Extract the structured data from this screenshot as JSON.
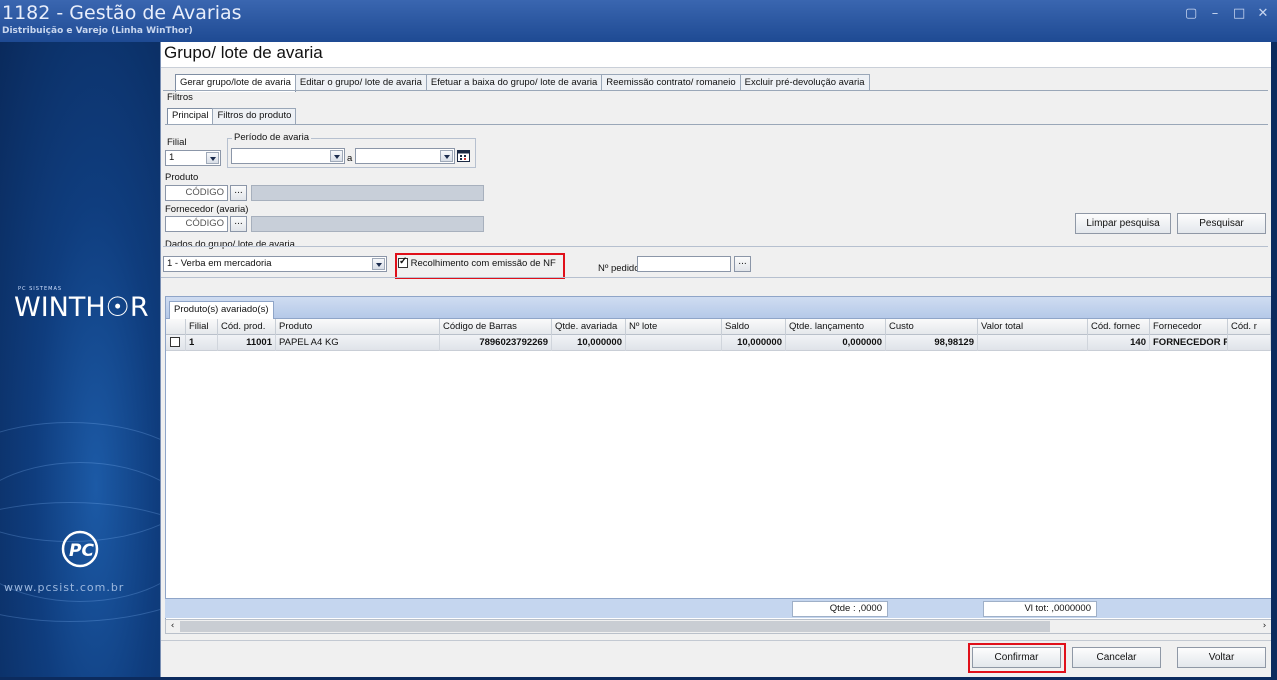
{
  "window": {
    "title": "1182 - Gestão de Avarias",
    "subtitle": "Distribuição e Varejo (Linha WinThor)",
    "controls": [
      "restore-icon",
      "minimize-icon",
      "maximize-icon",
      "close-icon"
    ]
  },
  "brand": {
    "small_text": "PC SISTEMAS",
    "logo_text": "WINTH☉R",
    "website": "www.pcsist.com.br"
  },
  "form": {
    "title": "Grupo/ lote de avaria",
    "tabs": [
      "Gerar grupo/lote de avaria",
      "Editar o grupo/ lote de avaria",
      "Efetuar a baixa do grupo/ lote de avaria",
      "Reemissão contrato/ romaneio",
      "Excluir pré-devolução avaria"
    ],
    "filters_label": "Filtros",
    "subtabs": [
      "Principal",
      "Filtros do produto"
    ],
    "filial_label": "Filial",
    "filial_value": "1",
    "periodo_label": "Período de avaria",
    "periodo_sep": "a",
    "produto_label": "Produto",
    "produto_code_placeholder": "CÓDIGO",
    "fornecedor_label": "Fornecedor (avaria)",
    "fornecedor_code_placeholder": "CÓDIGO",
    "limpar_label": "Limpar pesquisa",
    "pesquisar_label": "Pesquisar",
    "dados_label": "Dados do grupo/ lote de avaria",
    "tipo_value": "1 - Verba em mercadoria",
    "recolhimento_label": "Recolhimento com emissão de NF",
    "recolhimento_checked": true,
    "pedido_label": "Nº pedido:",
    "dots": "..."
  },
  "grid": {
    "tab_label": "Produto(s) avariado(s)",
    "columns": [
      "Filial",
      "Cód. prod.",
      "Produto",
      "Código de Barras",
      "Qtde. avariada",
      "Nº lote",
      "Saldo",
      "Qtde. lançamento",
      "Custo",
      "Valor total",
      "Cód. fornec",
      "Fornecedor",
      "Cód. r"
    ],
    "rows": [
      {
        "filial": "1",
        "cod_prod": "11001",
        "produto": "PAPEL A4 KG",
        "codigo_barras": "7896023792269",
        "qtde_avariada": "10,000000",
        "num_lote": "",
        "saldo": "10,000000",
        "qtde_lancamento": "0,000000",
        "custo": "98,98129",
        "valor_total": "",
        "cod_fornec": "140",
        "fornecedor": "FORNECEDOR PA",
        "cod_r": ""
      }
    ],
    "sum_qtde": "Qtde : ,0000",
    "sum_vltot": "Vl tot: ,0000000"
  },
  "actions": {
    "confirmar": "Confirmar",
    "cancelar": "Cancelar",
    "voltar": "Voltar"
  },
  "colors": {
    "highlight": "#e0101a",
    "titlebar": "#2a57a2",
    "grid_band": "#c5d6ef"
  }
}
